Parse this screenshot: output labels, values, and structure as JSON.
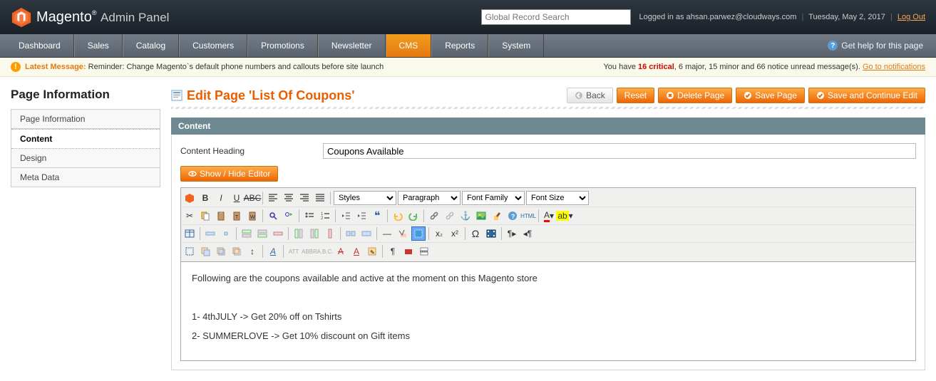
{
  "header": {
    "logo_main": "Magento",
    "logo_sub": "Admin Panel",
    "search_placeholder": "Global Record Search",
    "logged_in_prefix": "Logged in as",
    "user": "ahsan.parwez@cloudways.com",
    "date": "Tuesday, May 2, 2017",
    "logout": "Log Out"
  },
  "nav": {
    "items": [
      "Dashboard",
      "Sales",
      "Catalog",
      "Customers",
      "Promotions",
      "Newsletter",
      "CMS",
      "Reports",
      "System"
    ],
    "active_index": 6,
    "help": "Get help for this page"
  },
  "messages": {
    "latest_label": "Latest Message:",
    "latest_text": "Reminder: Change Magento`s default phone numbers and callouts before site launch",
    "unread_prefix": "You have",
    "critical_count": "16 critical",
    "unread_rest": ", 6 major, 15 minor and 66 notice unread message(s).",
    "notif_link": "Go to notifications"
  },
  "sidebar": {
    "title": "Page Information",
    "items": [
      "Page Information",
      "Content",
      "Design",
      "Meta Data"
    ],
    "active_index": 1
  },
  "page": {
    "title": "Edit Page 'List Of Coupons'",
    "buttons": {
      "back": "Back",
      "reset": "Reset",
      "delete": "Delete Page",
      "save": "Save Page",
      "save_continue": "Save and Continue Edit"
    }
  },
  "content_section": {
    "title": "Content",
    "heading_label": "Content Heading",
    "heading_value": "Coupons Available",
    "toggle_editor": "Show / Hide Editor"
  },
  "editor": {
    "selects": [
      "Styles",
      "Paragraph",
      "Font Family",
      "Font Size"
    ],
    "body": {
      "intro": "Following are the coupons available and active at the moment on this Magento store",
      "line1": "1- 4thJULY -> Get 20% off on Tshirts",
      "line2": "2- SUMMERLOVE -> Get 10% discount on Gift items"
    }
  }
}
